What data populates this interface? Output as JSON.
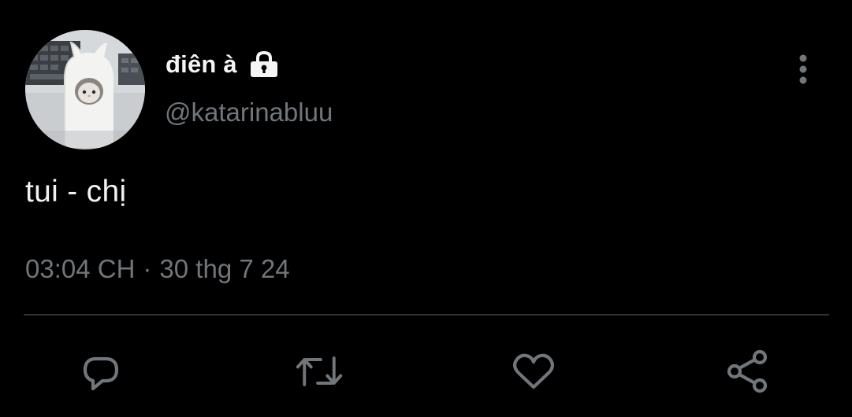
{
  "user": {
    "display_name": "điên à",
    "handle": "@katarinabluu",
    "verified_lock": "lock-icon",
    "avatar": "ghost-cat-figurine-avatar"
  },
  "tweet": {
    "text": "tui - chị",
    "time": "03:04 CH",
    "separator": "·",
    "date": "30 thg 7 24"
  },
  "actions": [
    {
      "name": "reply",
      "icon": "comment-icon"
    },
    {
      "name": "retweet",
      "icon": "retweet-icon"
    },
    {
      "name": "like",
      "icon": "heart-icon"
    },
    {
      "name": "share",
      "icon": "share-icon"
    }
  ],
  "colors": {
    "background": "#000000",
    "primary_text": "#e7e9ea",
    "secondary_text": "#71767b",
    "divider": "#2f3336",
    "icon": "#71767b"
  }
}
